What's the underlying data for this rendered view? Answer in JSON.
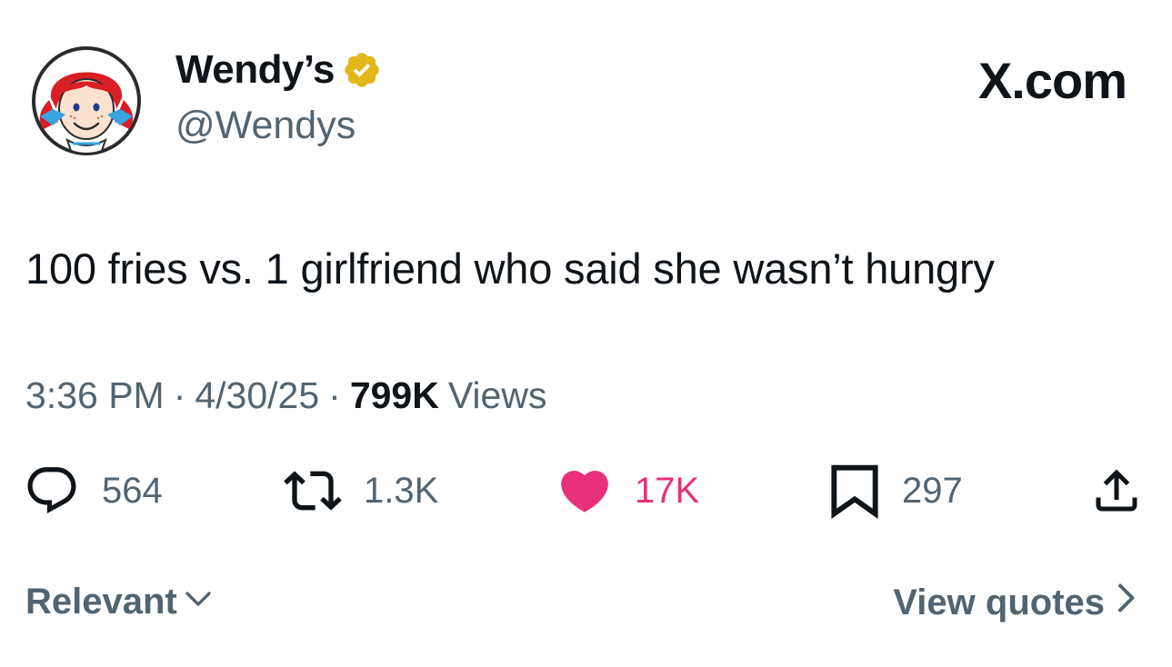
{
  "header": {
    "display_name": "Wendy’s",
    "handle": "@Wendys",
    "brand": "X.com",
    "verified_color": "#E2B719"
  },
  "tweet": {
    "text": "100 fries vs. 1 girlfriend who said she wasn’t hungry"
  },
  "meta": {
    "time": "3:36 PM",
    "separator": "·",
    "date": "4/30/25",
    "views_count": "799K",
    "views_label": "Views"
  },
  "actions": {
    "replies": "564",
    "reposts": "1.3K",
    "likes": "17K",
    "bookmarks": "297",
    "like_color": "#E8307B"
  },
  "footer": {
    "sort_label": "Relevant",
    "view_quotes_label": "View quotes"
  }
}
